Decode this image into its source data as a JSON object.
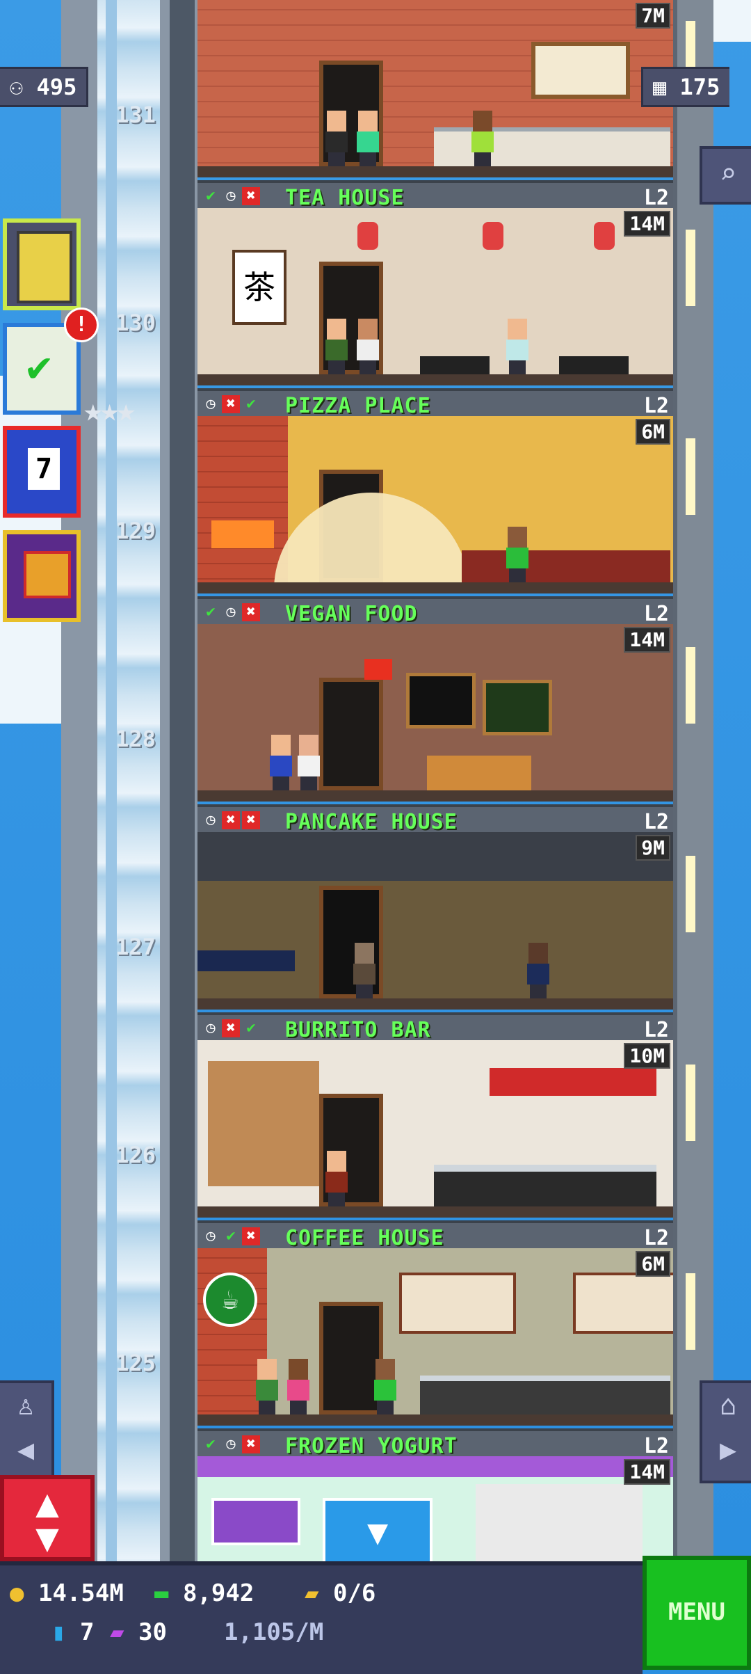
{
  "top": {
    "population": "495",
    "bux": "175"
  },
  "floors": [
    {
      "number": "131",
      "name": "",
      "level": "",
      "capacity": "7M",
      "icons": []
    },
    {
      "number": "130",
      "name": "TEA HOUSE",
      "level": "L2",
      "capacity": "14M",
      "icons": [
        "check",
        "clock",
        "x"
      ]
    },
    {
      "number": "129",
      "name": "PIZZA PLACE",
      "level": "L2",
      "capacity": "6M",
      "icons": [
        "clock",
        "x",
        "check"
      ]
    },
    {
      "number": "128",
      "name": "VEGAN FOOD",
      "level": "L2",
      "capacity": "14M",
      "icons": [
        "check",
        "clock",
        "x"
      ]
    },
    {
      "number": "127",
      "name": "PANCAKE HOUSE",
      "level": "L2",
      "capacity": "9M",
      "icons": [
        "clock",
        "x",
        "x"
      ]
    },
    {
      "number": "126",
      "name": "BURRITO BAR",
      "level": "L2",
      "capacity": "10M",
      "icons": [
        "clock",
        "x",
        "check"
      ]
    },
    {
      "number": "125",
      "name": "COFFEE HOUSE",
      "level": "L2",
      "capacity": "6M",
      "icons": [
        "clock",
        "check",
        "x"
      ]
    },
    {
      "number": "",
      "name": "FROZEN YOGURT",
      "level": "L2",
      "capacity": "14M",
      "icons": [
        "check",
        "clock",
        "x"
      ]
    }
  ],
  "sidebar": {
    "badge": "!",
    "calendar_day": "7"
  },
  "room_text": {
    "tea_sign": "茶"
  },
  "bottom": {
    "coins": "14.54M",
    "bux": "8,942",
    "tickets": "0/6",
    "keys": "7",
    "vip": "30",
    "income": "1,105/M"
  },
  "menu_label": "MENU",
  "colors": {
    "accent_green": "#66ff5a",
    "bar": "#5b6471",
    "menu": "#18c020"
  }
}
